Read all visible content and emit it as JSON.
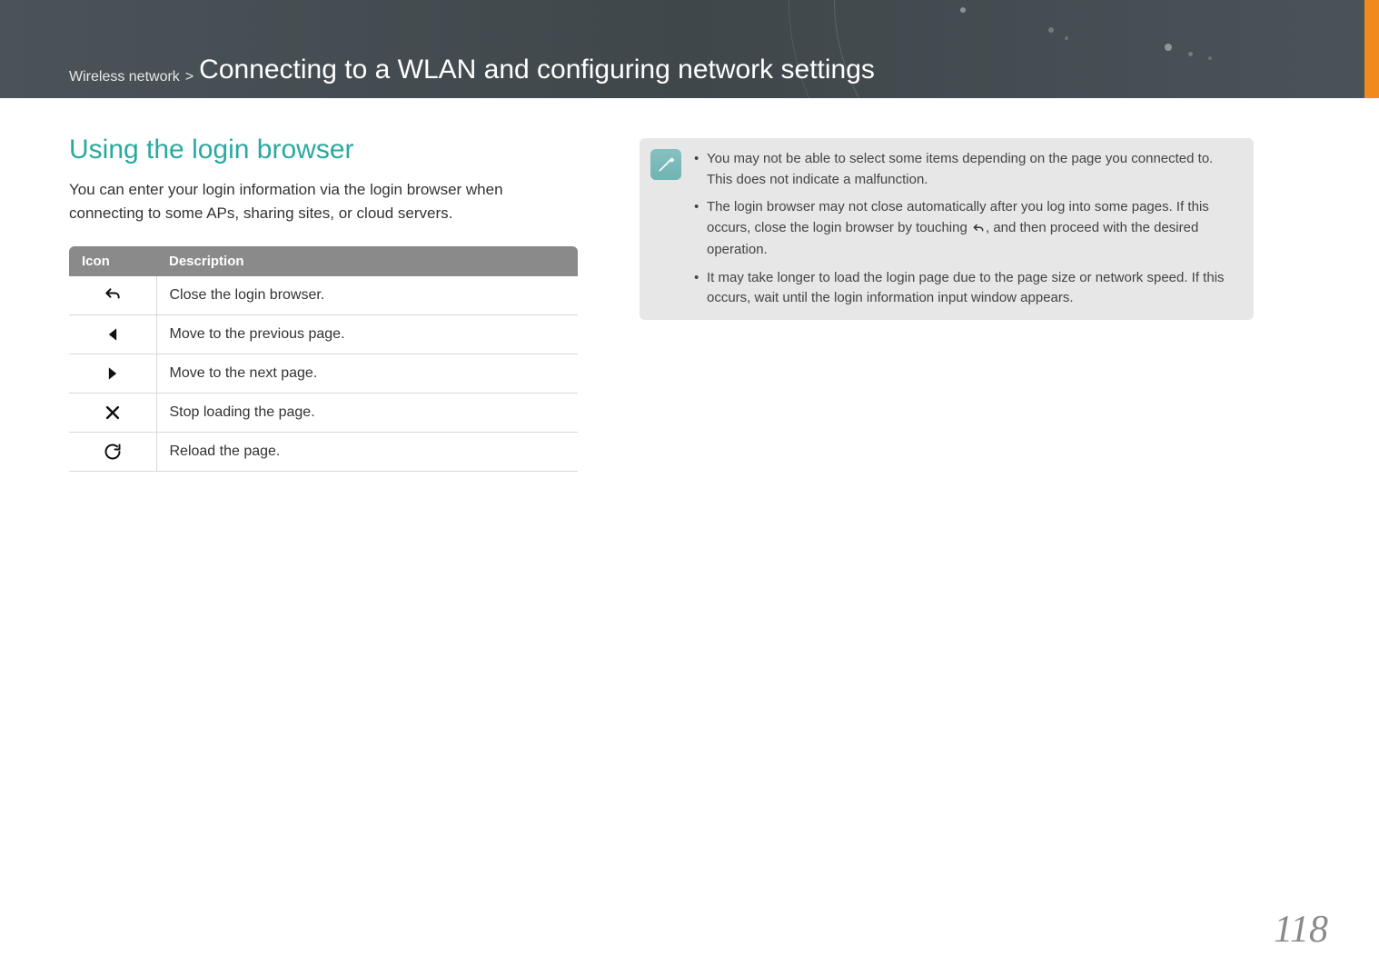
{
  "header": {
    "breadcrumb_prefix": "Wireless network",
    "breadcrumb_separator": ">",
    "breadcrumb_title": "Connecting to a WLAN and configuring network settings"
  },
  "section": {
    "heading": "Using the login browser",
    "body": "You can enter your login information via the login browser when connecting to some APs, sharing sites, or cloud servers."
  },
  "table": {
    "header_icon": "Icon",
    "header_desc": "Description",
    "rows": [
      {
        "icon_name": "back-icon",
        "desc": "Close the login browser."
      },
      {
        "icon_name": "prev-icon",
        "desc": "Move to the previous page."
      },
      {
        "icon_name": "next-icon",
        "desc": "Move to the next page."
      },
      {
        "icon_name": "stop-icon",
        "desc": "Stop loading the page."
      },
      {
        "icon_name": "reload-icon",
        "desc": "Reload the page."
      }
    ]
  },
  "notes": {
    "item1": "You may not be able to select some items depending on the page you connected to. This does not indicate a malfunction.",
    "item2_a": "The login browser may not close automatically after you log into some pages. If this occurs, close the login browser by touching ",
    "item2_b": ", and then proceed with the desired operation.",
    "item3": "It may take longer to load the login page due to the page size or network speed. If this occurs, wait until the login information input window appears."
  },
  "page_number": "118",
  "chart_data": {
    "type": "table",
    "columns": [
      "Icon",
      "Description"
    ],
    "rows": [
      [
        "↶ (back)",
        "Close the login browser."
      ],
      [
        "◀ (previous)",
        "Move to the previous page."
      ],
      [
        "▶ (next)",
        "Move to the next page."
      ],
      [
        "✕ (stop)",
        "Stop loading the page."
      ],
      [
        "⟳ (reload)",
        "Reload the page."
      ]
    ]
  }
}
